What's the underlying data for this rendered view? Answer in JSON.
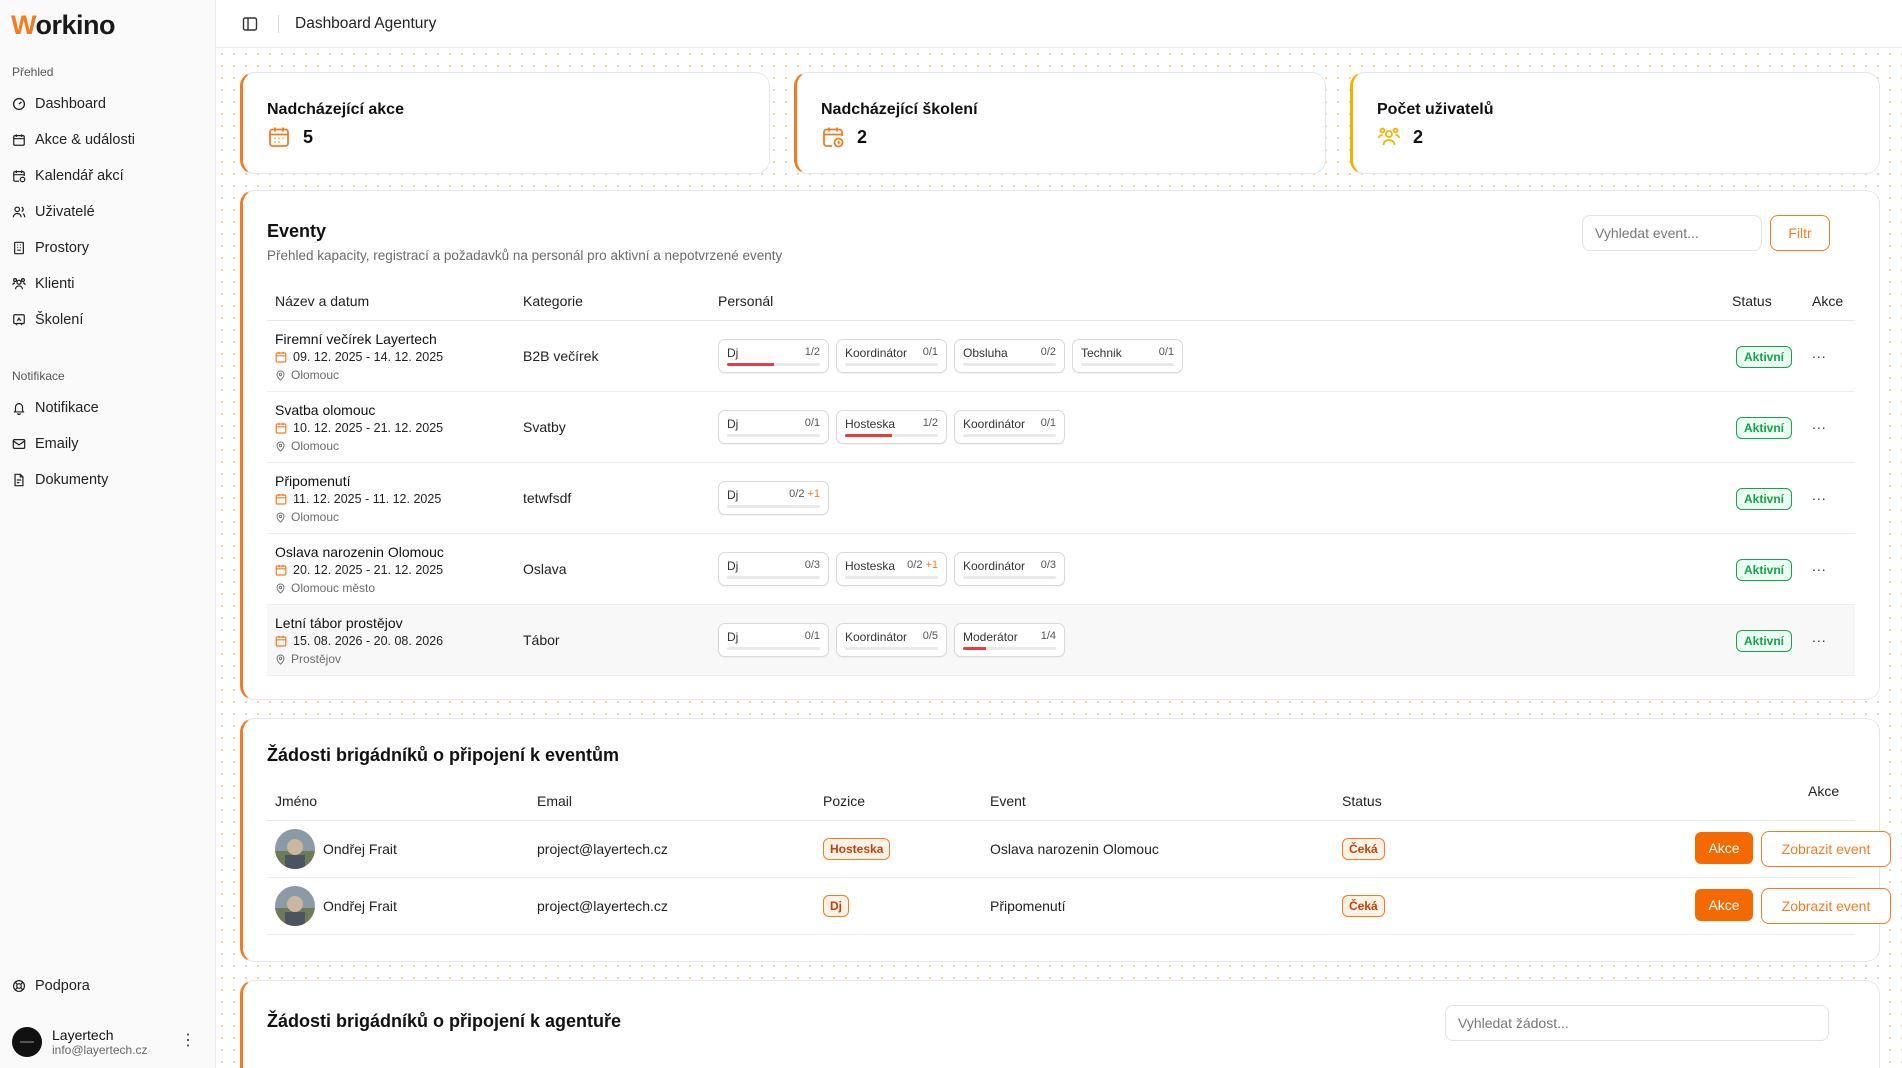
{
  "app": {
    "logo_letter": "W",
    "logo_rest": "orkino"
  },
  "sidebar": {
    "section_overview": "Přehled",
    "items": [
      {
        "label": "Dashboard",
        "icon": "gauge-icon"
      },
      {
        "label": "Akce & události",
        "icon": "calendar-icon"
      },
      {
        "label": "Kalendář akcí",
        "icon": "calendar-clock-icon"
      },
      {
        "label": "Uživatelé",
        "icon": "users-icon"
      },
      {
        "label": "Prostory",
        "icon": "building-icon"
      },
      {
        "label": "Klienti",
        "icon": "clients-icon"
      },
      {
        "label": "Školení",
        "icon": "presentation-icon"
      }
    ],
    "section_notifications": "Notifikace",
    "notif_items": [
      {
        "label": "Notifikace",
        "icon": "bell-icon"
      },
      {
        "label": "Emaily",
        "icon": "mail-icon"
      },
      {
        "label": "Dokumenty",
        "icon": "document-icon"
      }
    ],
    "support_label": "Podpora",
    "user": {
      "name": "Layertech",
      "email": "info@layertech.cz"
    }
  },
  "header": {
    "title": "Dashboard Agentury"
  },
  "stats": [
    {
      "title": "Nadcházející akce",
      "value": "5",
      "icon": "calendar-icon"
    },
    {
      "title": "Nadcházející školení",
      "value": "2",
      "icon": "calendar-clock-icon"
    },
    {
      "title": "Počet uživatelů",
      "value": "2",
      "icon": "users-icon"
    }
  ],
  "events": {
    "title": "Eventy",
    "subtitle": "Přehled kapacity, registrací a požadavků na personál pro aktivní a nepotvrzené eventy",
    "search_placeholder": "Vyhledat event...",
    "filter_label": "Filtr",
    "columns": {
      "name": "Název a datum",
      "category": "Kategorie",
      "staff": "Personál",
      "status": "Status",
      "actions": "Akce"
    },
    "rows": [
      {
        "name": "Firemní večírek Layertech",
        "date": "09. 12. 2025 - 14. 12. 2025",
        "location": "Olomouc",
        "category": "B2B večírek",
        "staff": [
          {
            "role": "Dj",
            "count": "1/2",
            "extra": "",
            "fill": 0.5
          },
          {
            "role": "Koordinátor",
            "count": "0/1",
            "extra": "",
            "fill": 0
          },
          {
            "role": "Obsluha",
            "count": "0/2",
            "extra": "",
            "fill": 0
          },
          {
            "role": "Technik",
            "count": "0/1",
            "extra": "",
            "fill": 0
          }
        ],
        "status": "Aktivní",
        "more": "..."
      },
      {
        "name": "Svatba olomouc",
        "date": "10. 12. 2025 - 21. 12. 2025",
        "location": "Olomouc",
        "category": "Svatby",
        "staff": [
          {
            "role": "Dj",
            "count": "0/1",
            "extra": "",
            "fill": 0
          },
          {
            "role": "Hosteska",
            "count": "1/2",
            "extra": "",
            "fill": 0.5
          },
          {
            "role": "Koordinátor",
            "count": "0/1",
            "extra": "",
            "fill": 0
          }
        ],
        "status": "Aktivní",
        "more": "..."
      },
      {
        "name": "Připomenutí",
        "date": "11. 12. 2025 - 11. 12. 2025",
        "location": "Olomouc",
        "category": "tetwfsdf",
        "staff": [
          {
            "role": "Dj",
            "count": "0/2",
            "extra": "+1",
            "fill": 0
          }
        ],
        "status": "Aktivní",
        "more": "..."
      },
      {
        "name": "Oslava narozenin Olomouc",
        "date": "20. 12. 2025 - 21. 12. 2025",
        "location": "Olomouc město",
        "category": "Oslava",
        "staff": [
          {
            "role": "Dj",
            "count": "0/3",
            "extra": "",
            "fill": 0
          },
          {
            "role": "Hosteska",
            "count": "0/2",
            "extra": "+1",
            "fill": 0
          },
          {
            "role": "Koordinátor",
            "count": "0/3",
            "extra": "",
            "fill": 0
          }
        ],
        "status": "Aktivní",
        "more": "..."
      },
      {
        "name": "Letní tábor prostějov",
        "date": "15. 08. 2026 - 20. 08. 2026",
        "location": "Prostějov",
        "category": "Tábor",
        "staff": [
          {
            "role": "Dj",
            "count": "0/1",
            "extra": "",
            "fill": 0
          },
          {
            "role": "Koordinátor",
            "count": "0/5",
            "extra": "",
            "fill": 0
          },
          {
            "role": "Moderátor",
            "count": "1/4",
            "extra": "",
            "fill": 0.25
          }
        ],
        "status": "Aktivní",
        "more": "..."
      }
    ]
  },
  "event_requests": {
    "title": "Žádosti brigádníků o připojení k eventům",
    "columns": {
      "name": "Jméno",
      "email": "Email",
      "position": "Pozice",
      "event": "Event",
      "status": "Status",
      "actions": "Akce"
    },
    "rows": [
      {
        "name": "Ondřej Frait",
        "email": "project@layertech.cz",
        "position": "Hosteska",
        "event": "Oslava narozenin Olomouc",
        "status": "Čeká",
        "action_label": "Akce",
        "view_label": "Zobrazit event"
      },
      {
        "name": "Ondřej Frait",
        "email": "project@layertech.cz",
        "position": "Dj",
        "event": "Připomenutí",
        "status": "Čeká",
        "action_label": "Akce",
        "view_label": "Zobrazit event"
      }
    ]
  },
  "agency_requests": {
    "title": "Žádosti brigádníků o připojení k agentuře",
    "search_placeholder": "Vyhledat žádost..."
  },
  "colors": {
    "accent": "#f47c20",
    "accent_solid": "#f56a00",
    "success": "#16a34a",
    "warning_yellow": "#f0b400",
    "progress_red": "#e53e3e"
  }
}
